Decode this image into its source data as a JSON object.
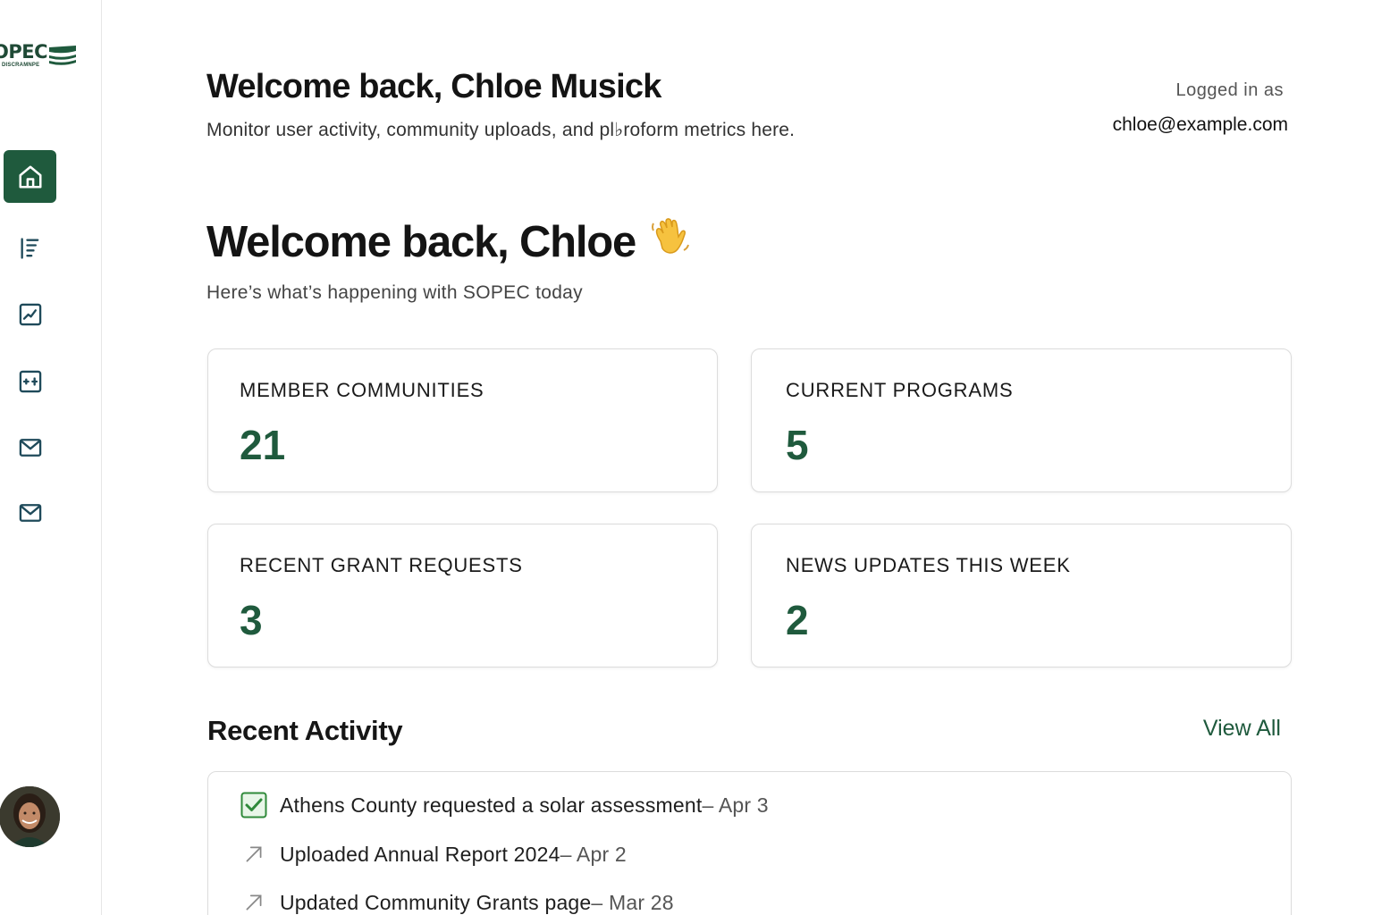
{
  "brand": {
    "logo_text": "OPEC",
    "logo_sub": "DISCRAMNPE",
    "primary_color": "#1f5a3d"
  },
  "sidebar": {
    "items": [
      {
        "icon": "home-icon",
        "active": true
      },
      {
        "icon": "list-icon",
        "active": false
      },
      {
        "icon": "chart-icon",
        "active": false
      },
      {
        "icon": "calculator-icon",
        "active": false
      },
      {
        "icon": "mail-icon",
        "active": false
      },
      {
        "icon": "mail-icon",
        "active": false
      }
    ],
    "avatar": "user-avatar"
  },
  "header": {
    "title": "Welcome back, Chloe Musick",
    "subtitle": "Monitor user activity, community uploads, and pl♭roform metrics here.",
    "logged_in_label": "Logged in as",
    "logged_in_email": "chloe@example.com"
  },
  "welcome": {
    "title": "Welcome back, Chloe",
    "emoji": "waving-hand",
    "subtitle": "Here’s what’s happening with SOPEC today"
  },
  "stats": [
    {
      "label": "MEMBER COMMUNITIES",
      "value": "21"
    },
    {
      "label": "CURRENT PROGRAMS",
      "value": "5"
    },
    {
      "label": "RECENT GRANT REQUESTS",
      "value": "3"
    },
    {
      "label": "NEWS UPDATES THIS WEEK",
      "value": "2"
    }
  ],
  "activity": {
    "title": "Recent Activity",
    "view_all": "View All",
    "items": [
      {
        "icon": "checkbox-checked-icon",
        "text": "Athens County requested a solar assessment",
        "date": " – Apr 3"
      },
      {
        "icon": "arrow-up-right-icon",
        "text": "Uploaded Annual Report 2024",
        "date": " – Apr 2"
      },
      {
        "icon": "arrow-up-right-icon",
        "text": "Updated Community Grants page",
        "date": " – Mar 28"
      }
    ]
  }
}
